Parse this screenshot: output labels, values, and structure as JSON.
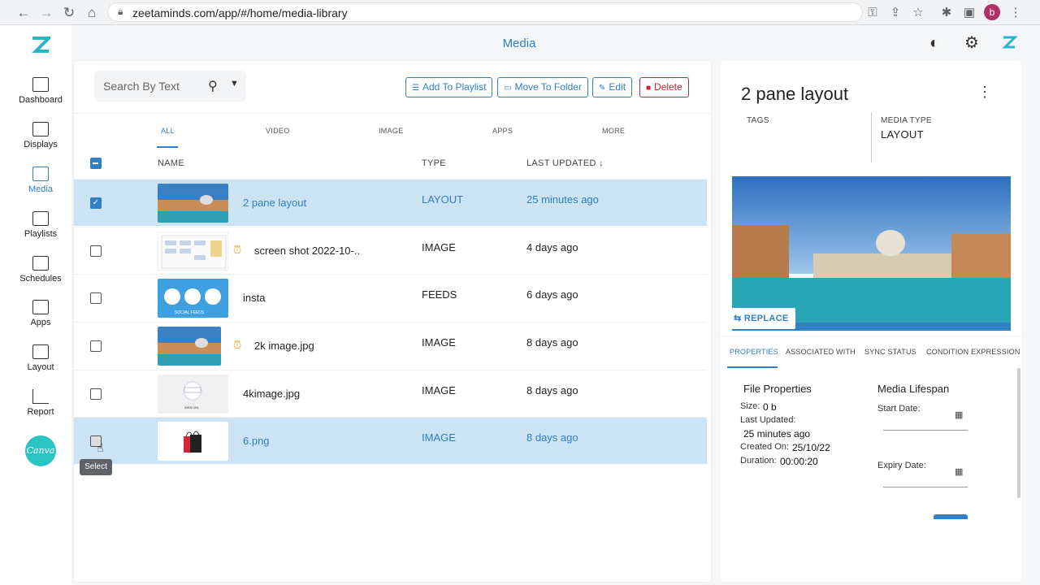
{
  "browser": {
    "url": "zeetaminds.com/app/#/home/media-library",
    "profile_initial": "b"
  },
  "header": {
    "title": "Media"
  },
  "sidebar": {
    "items": [
      {
        "label": "Dashboard",
        "icon": "dashboard-icon"
      },
      {
        "label": "Displays",
        "icon": "monitor-icon"
      },
      {
        "label": "Media",
        "icon": "image-icon",
        "active": true
      },
      {
        "label": "Playlists",
        "icon": "playlist-icon"
      },
      {
        "label": "Schedules",
        "icon": "calendar-icon"
      },
      {
        "label": "Apps",
        "icon": "apps-icon"
      },
      {
        "label": "Layout",
        "icon": "layout-icon"
      },
      {
        "label": "Report",
        "icon": "chart-icon"
      }
    ],
    "canva_label": "Canva"
  },
  "toolbar": {
    "search_placeholder": "Search By Text",
    "add_to_playlist": "Add To Playlist",
    "move_to_folder": "Move To Folder",
    "edit": "Edit",
    "delete": "Delete"
  },
  "tabs": [
    "ALL",
    "VIDEO",
    "IMAGE",
    "APPS",
    "MORE"
  ],
  "table": {
    "headers": {
      "name": "NAME",
      "type": "TYPE",
      "last_updated": "LAST UPDATED"
    },
    "rows": [
      {
        "name": "2 pane layout",
        "type": "LAYOUT",
        "updated": "25 minutes ago",
        "selected": true,
        "checked": true,
        "thumb": "venice",
        "clock": false
      },
      {
        "name": "screen shot 2022-10-..",
        "type": "IMAGE",
        "updated": "4 days ago",
        "selected": false,
        "checked": false,
        "thumb": "calendar",
        "clock": true
      },
      {
        "name": "insta",
        "type": "FEEDS",
        "updated": "6 days ago",
        "selected": false,
        "checked": false,
        "thumb": "social",
        "clock": false
      },
      {
        "name": "2k image.jpg",
        "type": "IMAGE",
        "updated": "8 days ago",
        "selected": false,
        "checked": false,
        "thumb": "venice",
        "clock": true
      },
      {
        "name": "4kimage.jpg",
        "type": "IMAGE",
        "updated": "8 days ago",
        "selected": false,
        "checked": false,
        "thumb": "weburl",
        "clock": false
      },
      {
        "name": "6.png",
        "type": "IMAGE",
        "updated": "8 days ago",
        "selected": true,
        "checked": false,
        "thumb": "bags",
        "clock": false
      }
    ],
    "social_feeds_text": "SOCIAL FEEDS",
    "web_url_text": "WEB URL"
  },
  "tooltip": "Select",
  "detail": {
    "title": "2 pane layout",
    "tags_label": "TAGS",
    "media_type_label": "MEDIA TYPE",
    "media_type_value": "LAYOUT",
    "replace": "REPLACE",
    "tabs": [
      "PROPERTIES",
      "ASSOCIATED WITH",
      "SYNC STATUS",
      "CONDITION EXPRESSION"
    ],
    "file_properties": "File Properties",
    "size_label": "Size:",
    "size_value": "0 b",
    "last_updated_label": "Last Updated:",
    "last_updated_value": "25 minutes ago",
    "created_on_label": "Created On:",
    "created_on_value": "25/10/22",
    "duration_label": "Duration:",
    "duration_value": "00:00:20",
    "lifespan": "Media Lifespan",
    "start_date_label": "Start Date:",
    "expiry_date_label": "Expiry Date:"
  },
  "colors": {
    "accent": "#2f80c6",
    "selected_row": "#cce3f3",
    "delete": "#c8233c",
    "canva": "#29c4c4"
  }
}
